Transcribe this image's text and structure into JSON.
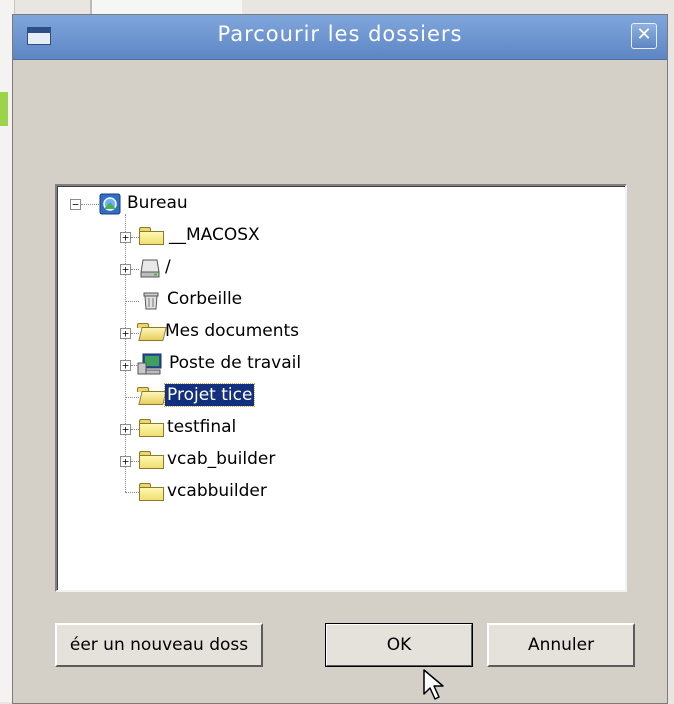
{
  "dialog": {
    "title": "Parcourir les dossiers",
    "close_label": "✕"
  },
  "tree": {
    "root": {
      "label": "Bureau",
      "icon": "desktop-icon"
    },
    "items": [
      {
        "label": "__MACOSX",
        "icon": "folder-icon",
        "expandable": true,
        "selected": false
      },
      {
        "label": "/",
        "icon": "drive-icon",
        "expandable": true,
        "selected": false
      },
      {
        "label": "Corbeille",
        "icon": "recycle-bin-icon",
        "expandable": false,
        "selected": false
      },
      {
        "label": "Mes documents",
        "icon": "open-folder-icon",
        "expandable": true,
        "selected": false
      },
      {
        "label": "Poste de travail",
        "icon": "computer-icon",
        "expandable": true,
        "selected": false
      },
      {
        "label": "Projet tice",
        "icon": "open-folder-icon",
        "expandable": false,
        "selected": true
      },
      {
        "label": "testfinal",
        "icon": "folder-icon",
        "expandable": true,
        "selected": false
      },
      {
        "label": "vcab_builder",
        "icon": "folder-icon",
        "expandable": true,
        "selected": false
      },
      {
        "label": "vcabbuilder",
        "icon": "folder-icon",
        "expandable": false,
        "selected": false
      }
    ]
  },
  "buttons": {
    "new_folder": "éer un nouveau doss",
    "ok": "OK",
    "cancel": "Annuler"
  },
  "colors": {
    "titlebar": "#6a92cf",
    "selection": "#12307e",
    "dialog_bg": "#d4d0c8"
  }
}
